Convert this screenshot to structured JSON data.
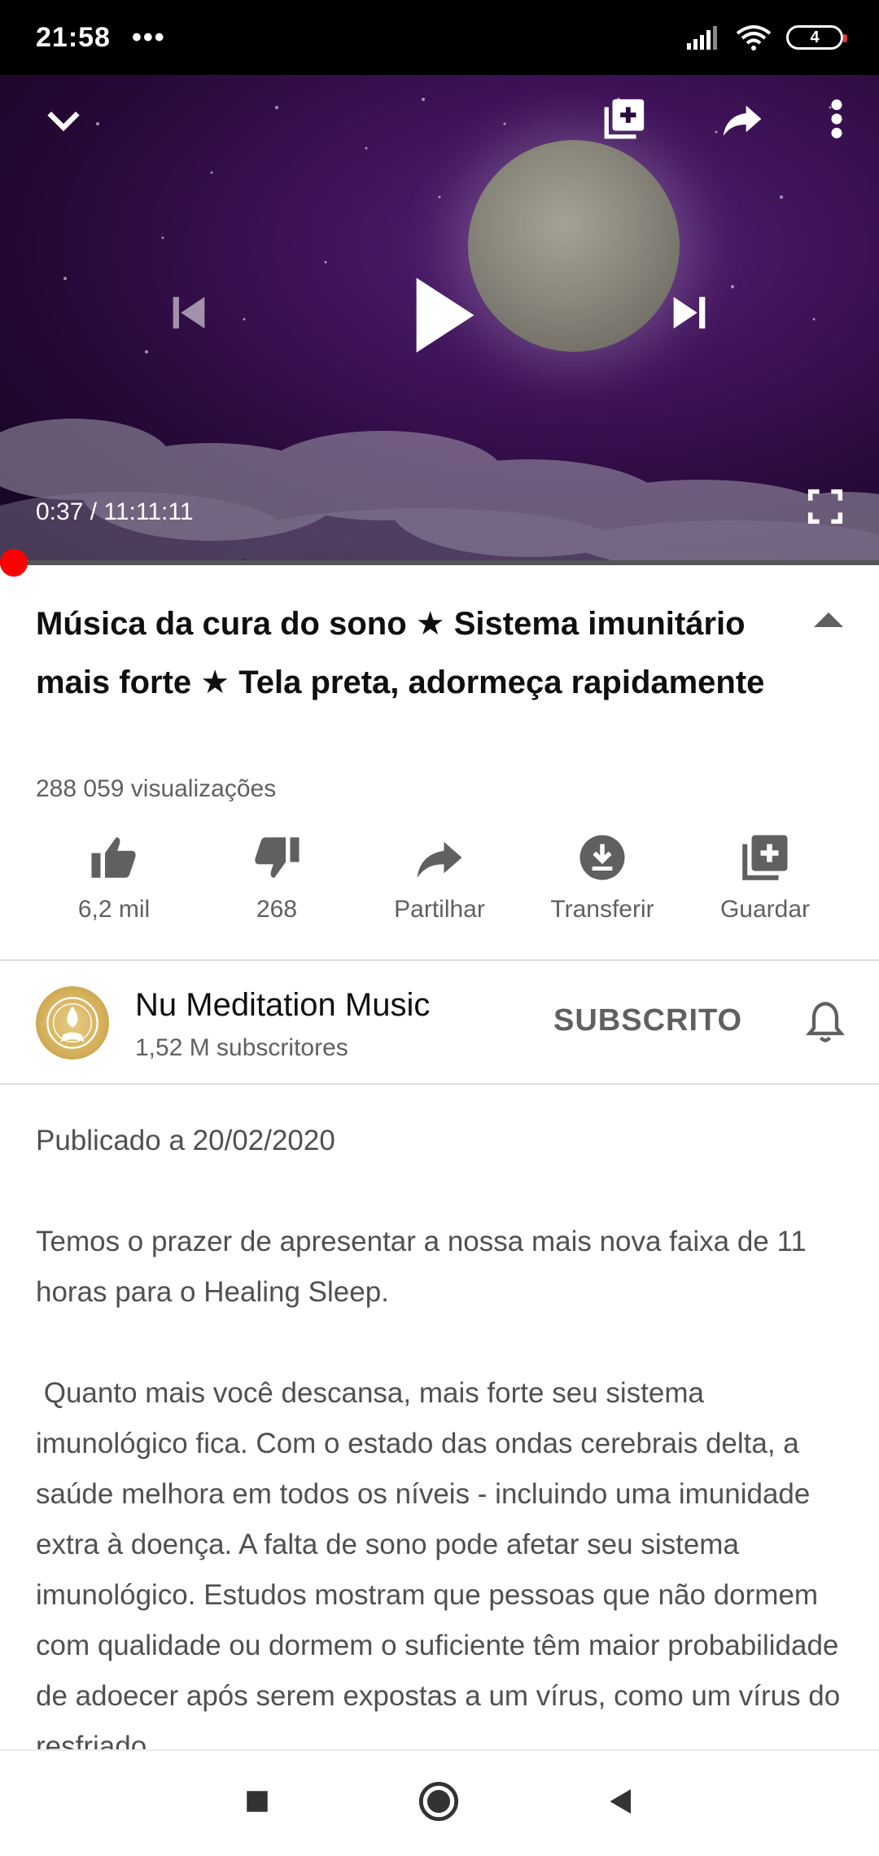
{
  "status_bar": {
    "time": "21:58",
    "dots": "•••",
    "battery": "4"
  },
  "player": {
    "current_time": "0:37",
    "separator": " / ",
    "duration": "11:11:11",
    "progress_fraction": 0.001
  },
  "video": {
    "title": "Música da cura do sono ★  Sistema imunitário mais forte ★ Tela preta, adormeça rapidamente",
    "views": "288 059 visualizações"
  },
  "actions": {
    "like": "6,2 mil",
    "dislike": "268",
    "share": "Partilhar",
    "download": "Transferir",
    "save": "Guardar"
  },
  "channel": {
    "name": "Nu Meditation Music",
    "subscribers": "1,52 M subscritores",
    "subscribe_label": "SUBSCRITO"
  },
  "description": {
    "published": "Publicado a 20/02/2020",
    "paragraph1": "Temos o prazer de apresentar a nossa mais nova faixa de 11 horas para o Healing Sleep.",
    "paragraph2": " Quanto mais você descansa, mais forte seu sistema imunológico fica. Com o estado das ondas cerebrais delta, a saúde melhora em todos os níveis - incluindo uma imunidade extra à doença. A falta de sono pode afetar seu sistema imunológico. Estudos mostram que pessoas que não dormem com qualidade ou dormem o suficiente têm maior probabilidade de adoecer após serem expostas a um vírus, como um vírus do resfriado"
  },
  "colors": {
    "accent": "#ff0000",
    "muted": "#606060"
  }
}
